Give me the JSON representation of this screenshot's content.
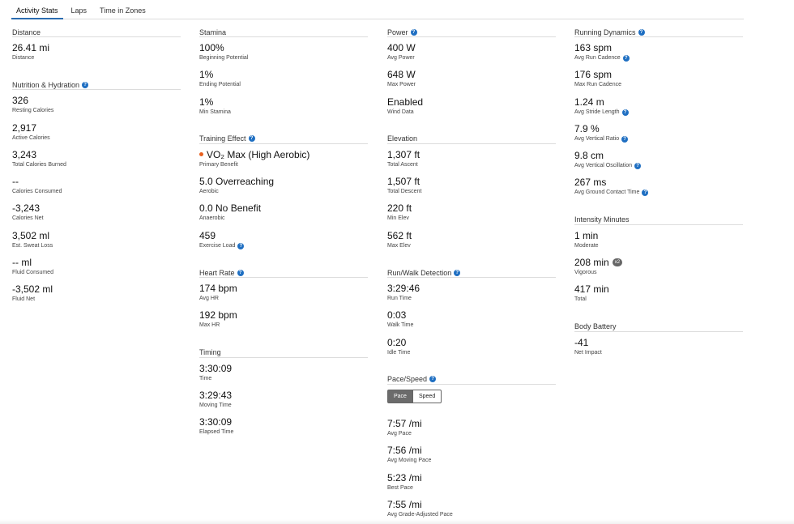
{
  "tabs": [
    "Activity Stats",
    "Laps",
    "Time in Zones"
  ],
  "col1": [
    {
      "title": "Distance",
      "help": false,
      "stats": [
        {
          "value": "26.41 mi",
          "label": "Distance"
        }
      ]
    },
    {
      "title": "Nutrition & Hydration",
      "help": true,
      "stats": [
        {
          "value": "326",
          "label": "Resting Calories"
        },
        {
          "value": "2,917",
          "label": "Active Calories"
        },
        {
          "value": "3,243",
          "label": "Total Calories Burned"
        },
        {
          "value": "--",
          "label": "Calories Consumed"
        },
        {
          "value": "-3,243",
          "label": "Calories Net"
        },
        {
          "value": "3,502 ml",
          "label": "Est. Sweat Loss"
        },
        {
          "value": "-- ml",
          "label": "Fluid Consumed"
        },
        {
          "value": "-3,502 ml",
          "label": "Fluid Net"
        }
      ]
    }
  ],
  "col2": [
    {
      "title": "Stamina",
      "help": false,
      "stats": [
        {
          "value": "100%",
          "label": "Beginning Potential"
        },
        {
          "value": "1%",
          "label": "Ending Potential"
        },
        {
          "value": "1%",
          "label": "Min Stamina"
        }
      ]
    },
    {
      "title": "Training Effect",
      "help": true,
      "stats": [
        {
          "value": "VO₂ Max (High Aerobic)",
          "label": "Primary Benefit",
          "dot": true
        },
        {
          "value": "5.0 Overreaching",
          "label": "Aerobic"
        },
        {
          "value": "0.0 No Benefit",
          "label": "Anaerobic"
        },
        {
          "value": "459",
          "label": "Exercise Load",
          "labelHelp": true
        }
      ]
    },
    {
      "title": "Heart Rate",
      "help": true,
      "stats": [
        {
          "value": "174 bpm",
          "label": "Avg HR"
        },
        {
          "value": "192 bpm",
          "label": "Max HR"
        }
      ]
    },
    {
      "title": "Timing",
      "help": false,
      "stats": [
        {
          "value": "3:30:09",
          "label": "Time"
        },
        {
          "value": "3:29:43",
          "label": "Moving Time"
        },
        {
          "value": "3:30:09",
          "label": "Elapsed Time"
        }
      ]
    }
  ],
  "col3": [
    {
      "title": "Power",
      "help": true,
      "stats": [
        {
          "value": "400 W",
          "label": "Avg Power"
        },
        {
          "value": "648 W",
          "label": "Max Power"
        },
        {
          "value": "Enabled",
          "label": "Wind Data"
        }
      ]
    },
    {
      "title": "Elevation",
      "help": false,
      "stats": [
        {
          "value": "1,307 ft",
          "label": "Total Ascent"
        },
        {
          "value": "1,507 ft",
          "label": "Total Descent"
        },
        {
          "value": "220 ft",
          "label": "Min Elev"
        },
        {
          "value": "562 ft",
          "label": "Max Elev"
        }
      ]
    },
    {
      "title": "Run/Walk Detection",
      "help": true,
      "stats": [
        {
          "value": "3:29:46",
          "label": "Run Time"
        },
        {
          "value": "0:03",
          "label": "Walk Time"
        },
        {
          "value": "0:20",
          "label": "Idle Time"
        }
      ]
    },
    {
      "title": "Pace/Speed",
      "help": true,
      "toggle": [
        "Pace",
        "Speed"
      ],
      "stats": [
        {
          "value": "7:57 /mi",
          "label": "Avg Pace"
        },
        {
          "value": "7:56 /mi",
          "label": "Avg Moving Pace"
        },
        {
          "value": "5:23 /mi",
          "label": "Best Pace"
        },
        {
          "value": "7:55 /mi",
          "label": "Avg Grade-Adjusted Pace"
        }
      ]
    }
  ],
  "col4": [
    {
      "title": "Running Dynamics",
      "help": true,
      "stats": [
        {
          "value": "163 spm",
          "label": "Avg Run Cadence",
          "labelHelp": true
        },
        {
          "value": "176 spm",
          "label": "Max Run Cadence"
        },
        {
          "value": "1.24 m",
          "label": "Avg Stride Length",
          "labelHelp": true
        },
        {
          "value": "7.9 %",
          "label": "Avg Vertical Ratio",
          "labelHelp": true
        },
        {
          "value": "9.8 cm",
          "label": "Avg Vertical Oscillation",
          "labelHelp": true
        },
        {
          "value": "267 ms",
          "label": "Avg Ground Contact Time",
          "labelHelp": true
        }
      ]
    },
    {
      "title": "Intensity Minutes",
      "help": false,
      "stats": [
        {
          "value": "1 min",
          "label": "Moderate"
        },
        {
          "value": "208 min",
          "label": "Vigorous",
          "badge": "x2"
        },
        {
          "value": "417 min",
          "label": "Total"
        }
      ]
    },
    {
      "title": "Body Battery",
      "help": false,
      "stats": [
        {
          "value": "-41",
          "label": "Net Impact"
        }
      ]
    }
  ],
  "help_glyph": "?",
  "colors": {
    "accent": "#1f6fc2",
    "orange": "#e8601f",
    "tab_active": "#2b6cb0"
  }
}
